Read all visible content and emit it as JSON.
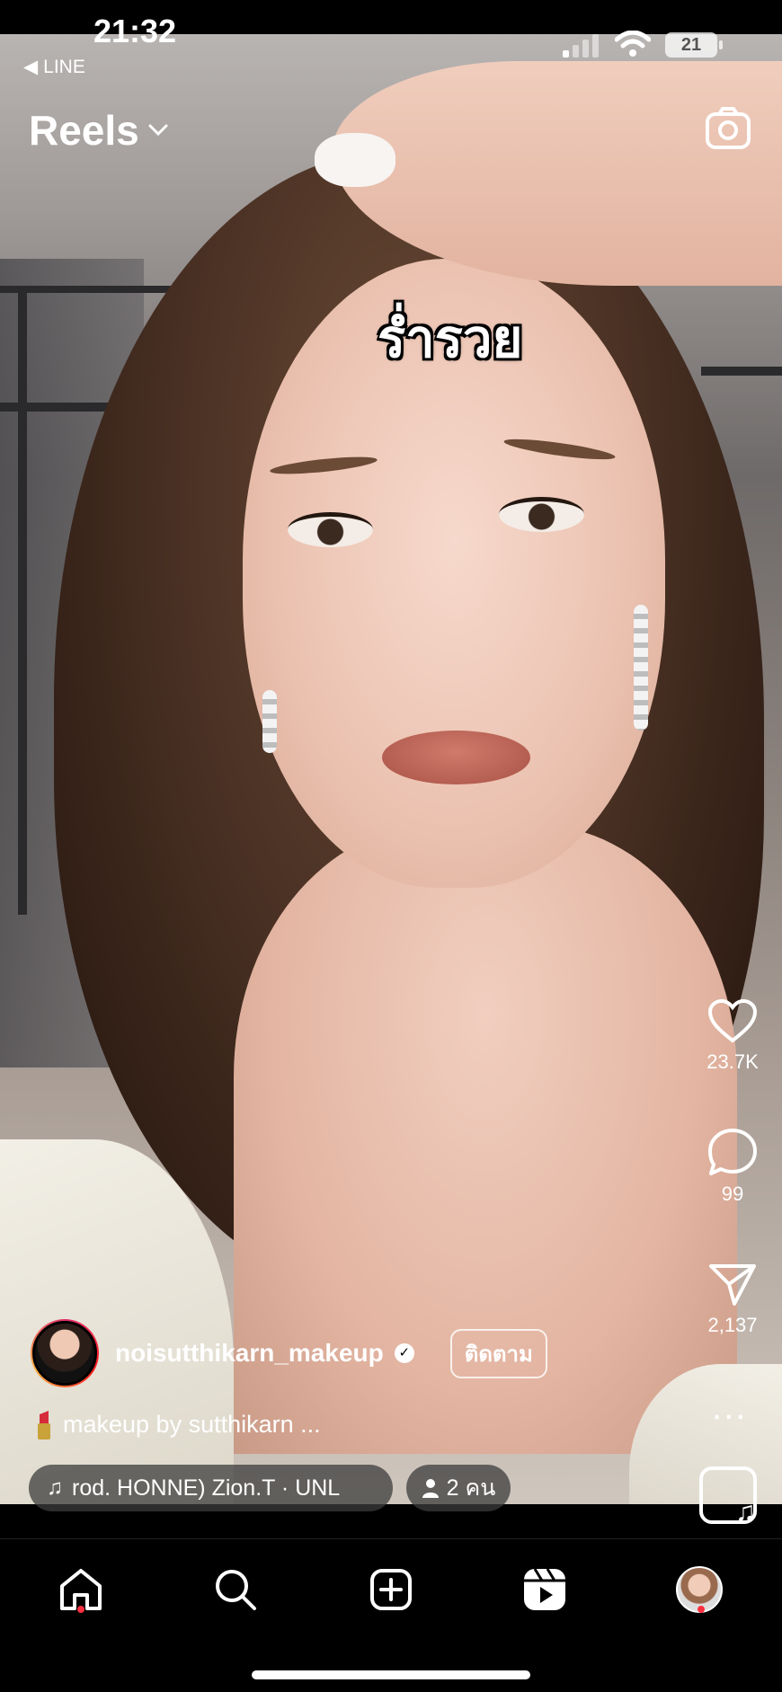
{
  "status_bar": {
    "time": "21:32",
    "back_app": "LINE",
    "battery": "21"
  },
  "header": {
    "title": "Reels"
  },
  "video": {
    "overlay_text": "ร่ำรวย"
  },
  "actions": {
    "likes": "23.7K",
    "comments": "99",
    "shares": "2,137",
    "more": "..."
  },
  "post": {
    "username": "noisutthikarn_makeup",
    "follow_label": "ติดตาม",
    "caption": "makeup by sutthikarn ...",
    "audio": "rod. HONNE)      Zion.T · UNL",
    "people": "2 คน"
  },
  "nav": {
    "items": [
      "home-icon",
      "search-icon",
      "create-icon",
      "reels-icon",
      "profile-avatar"
    ]
  }
}
